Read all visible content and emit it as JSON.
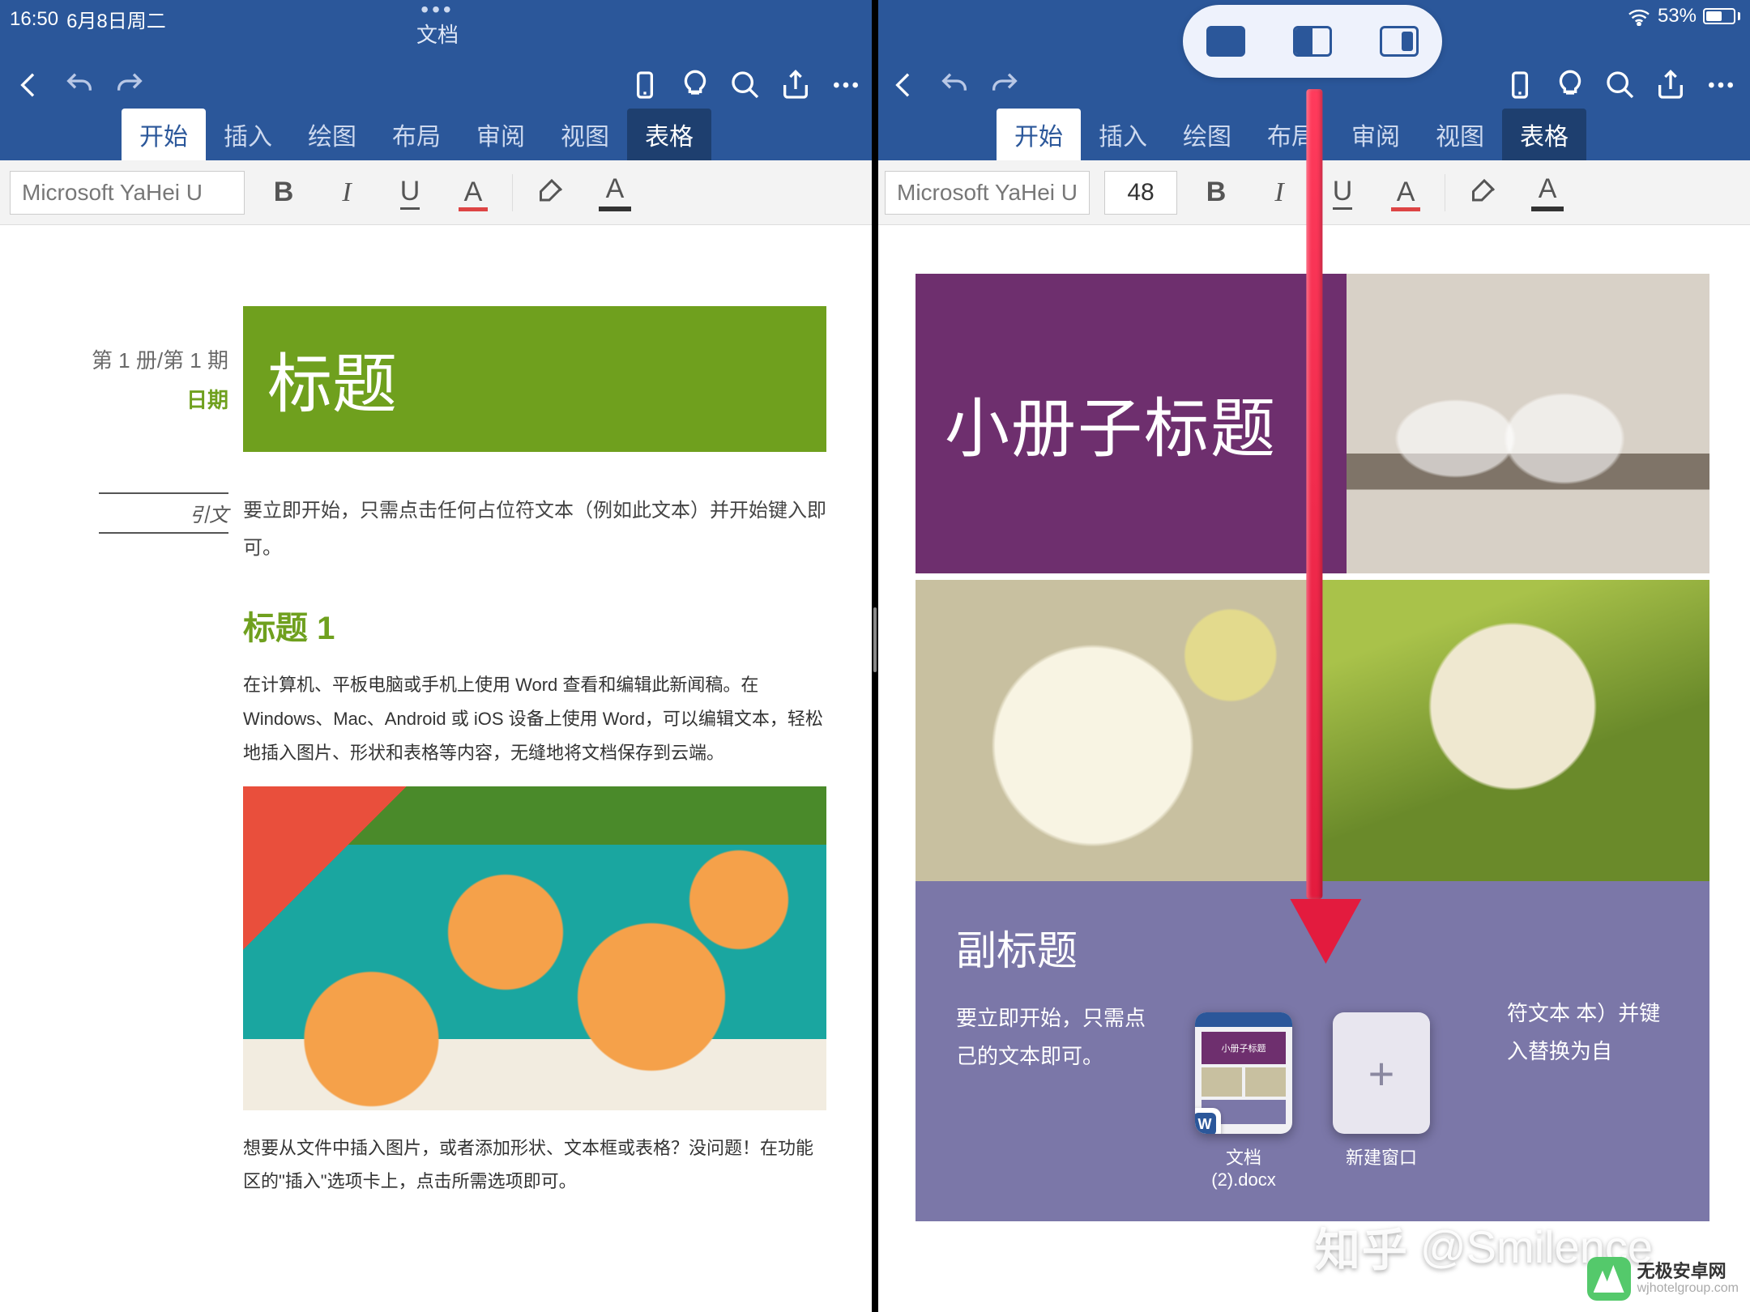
{
  "status": {
    "time": "16:50",
    "date": "6月8日周二",
    "battery": "53%"
  },
  "doc_title": "文档",
  "ribbon": {
    "tabs": [
      "开始",
      "插入",
      "绘图",
      "布局",
      "审阅",
      "视图",
      "表格"
    ]
  },
  "format": {
    "font": "Microsoft YaHei U",
    "size": "48"
  },
  "left_doc": {
    "issue": "第 1 册/第 1 期",
    "date_label": "日期",
    "title": "标题",
    "quote_label": "引文",
    "quote_text": "要立即开始，只需点击任何占位符文本（例如此文本）并开始键入即可。",
    "heading1": "标题 1",
    "para1": "在计算机、平板电脑或手机上使用 Word 查看和编辑此新闻稿。在 Windows、Mac、Android 或 iOS 设备上使用 Word，可以编辑文本，轻松地插入图片、形状和表格等内容，无缝地将文档保存到云端。",
    "para2": "想要从文件中插入图片，或者添加形状、文本框或表格？没问题！在功能区的\"插入\"选项卡上，点击所需选项即可。"
  },
  "right_doc": {
    "hero_title": "小册子标题",
    "sub_title": "副标题",
    "sub_text1": "要立即开始，只需点",
    "sub_text1b": "己的文本即可。",
    "sub_text2a": "符文本",
    "sub_text2b": "本）并键入替换为自"
  },
  "dock": {
    "thumb1_line1": "文档",
    "thumb1_line2": "(2).docx",
    "thumb2": "新建窗口"
  },
  "watermark": {
    "zhihu_brand": "知乎",
    "zhihu_user": "@Smilence",
    "wuji_name": "无极安卓网",
    "wuji_url": "wjhotelgroup.com"
  }
}
